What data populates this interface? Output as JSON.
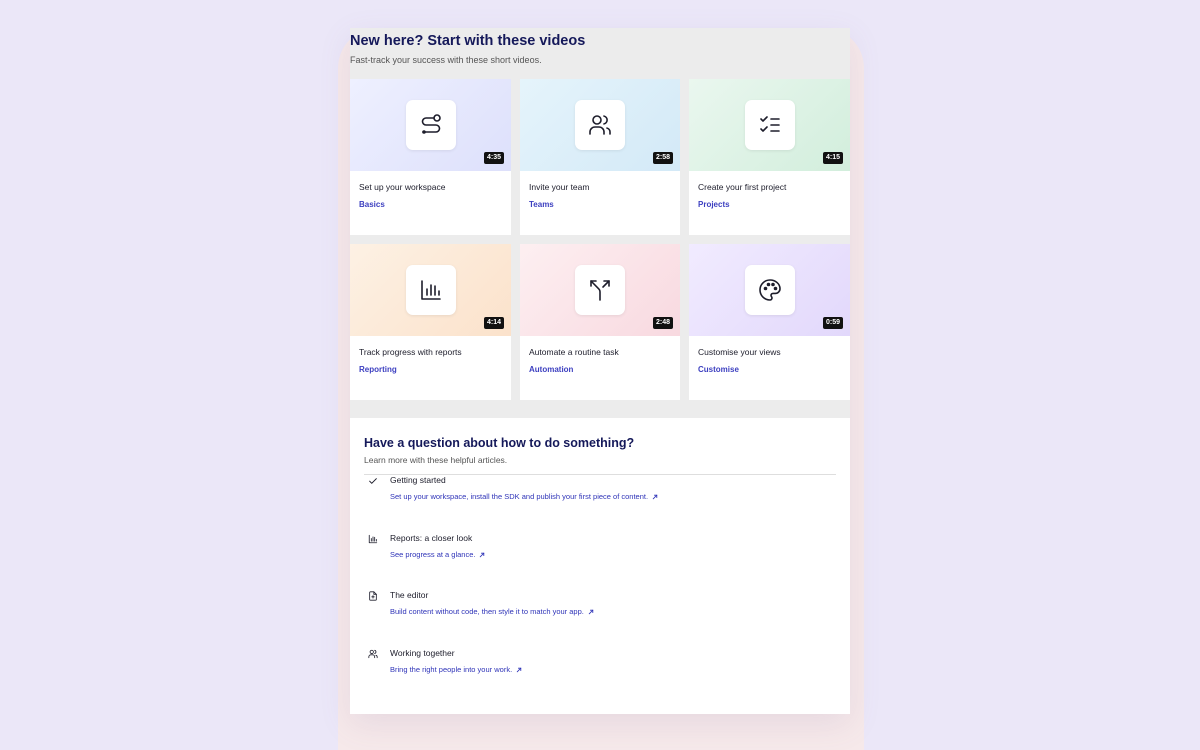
{
  "videos": {
    "title": "New here? Start with these videos",
    "subtitle": "Fast-track your success with these short videos.",
    "cards": [
      {
        "title": "Set up your workspace",
        "tag": "Basics",
        "duration": "4:35",
        "icon": "route-icon"
      },
      {
        "title": "Invite your team",
        "tag": "Teams",
        "duration": "2:58",
        "icon": "users-icon"
      },
      {
        "title": "Create your first project",
        "tag": "Projects",
        "duration": "4:15",
        "icon": "checklist-icon"
      },
      {
        "title": "Track progress with reports",
        "tag": "Reporting",
        "duration": "4:14",
        "icon": "bar-chart-icon"
      },
      {
        "title": "Automate a routine task",
        "tag": "Automation",
        "duration": "2:48",
        "icon": "split-arrow-icon"
      },
      {
        "title": "Customise your views",
        "tag": "Customise",
        "duration": "0:59",
        "icon": "palette-icon"
      }
    ]
  },
  "articles": {
    "title": "Have a question about how to do something?",
    "subtitle": "Learn more with these helpful articles.",
    "items": [
      {
        "title": "Getting started",
        "link": "Set up your workspace, install the SDK and publish your first piece of content.",
        "icon": "check-icon"
      },
      {
        "title": "Reports: a closer look",
        "link": "See progress at a glance.",
        "icon": "bar-chart-icon"
      },
      {
        "title": "The editor",
        "link": "Build content without code, then style it to match your app.",
        "icon": "document-icon"
      },
      {
        "title": "Working together",
        "link": "Bring the right people into your work.",
        "icon": "users-icon"
      }
    ]
  },
  "colors": {
    "heading": "#15195a",
    "link": "#2f34b8",
    "tag": "#3c3fc0",
    "background": "#ebe7f8"
  }
}
